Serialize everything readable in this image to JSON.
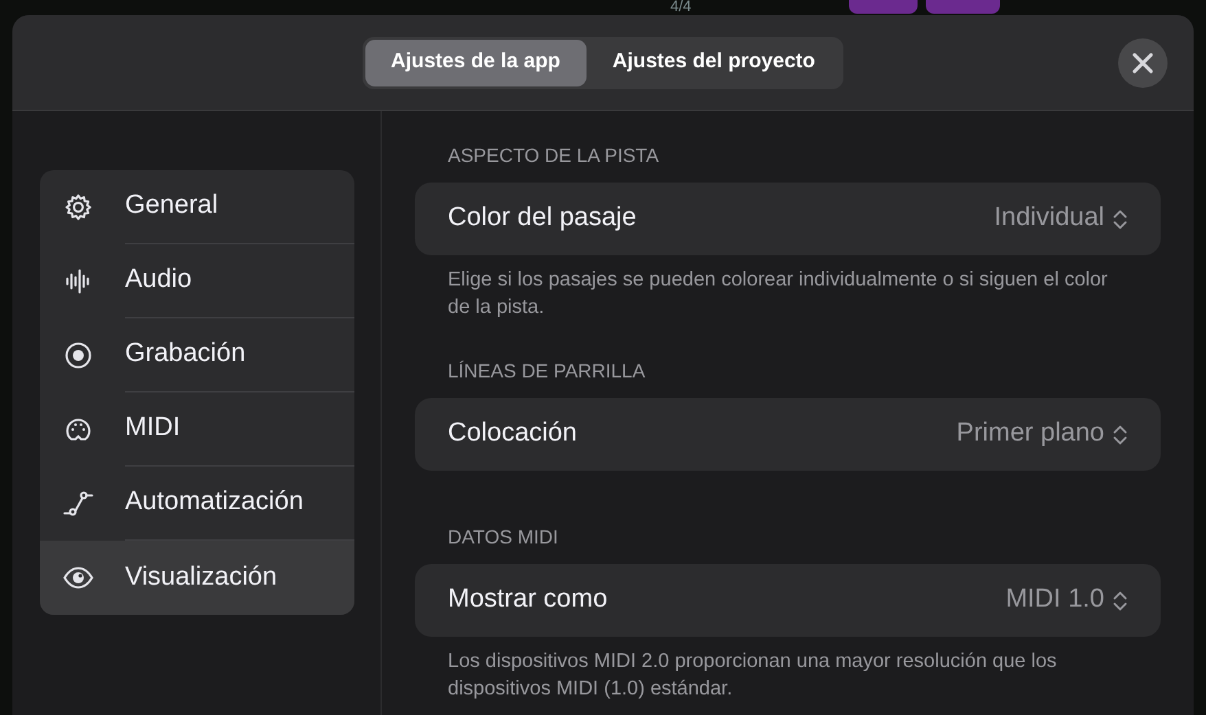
{
  "background_app": {
    "time_signature": "4/4"
  },
  "tabs": [
    {
      "label": "Ajustes de la app",
      "selected": true
    },
    {
      "label": "Ajustes del proyecto",
      "selected": false
    }
  ],
  "sidebar": {
    "items": [
      {
        "label": "General",
        "selected": false
      },
      {
        "label": "Audio",
        "selected": false
      },
      {
        "label": "Grabación",
        "selected": false
      },
      {
        "label": "MIDI",
        "selected": false
      },
      {
        "label": "Automatización",
        "selected": false
      },
      {
        "label": "Visualización",
        "selected": true
      }
    ]
  },
  "sections": [
    {
      "header": "ASPECTO DE LA PISTA",
      "rows": [
        {
          "label": "Color del pasaje",
          "value": "Individual"
        }
      ],
      "footer": "Elige si los pasajes se pueden colorear individualmente o si siguen el color de la pista."
    },
    {
      "header": "LÍNEAS DE PARRILLA",
      "rows": [
        {
          "label": "Colocación",
          "value": "Primer plano"
        }
      ]
    },
    {
      "header": "DATOS MIDI",
      "rows": [
        {
          "label": "Mostrar como",
          "value": "MIDI 1.0"
        }
      ],
      "footer": "Los dispositivos MIDI 2.0 proporcionan una mayor resolución que los dispositivos MIDI (1.0) estándar."
    }
  ]
}
